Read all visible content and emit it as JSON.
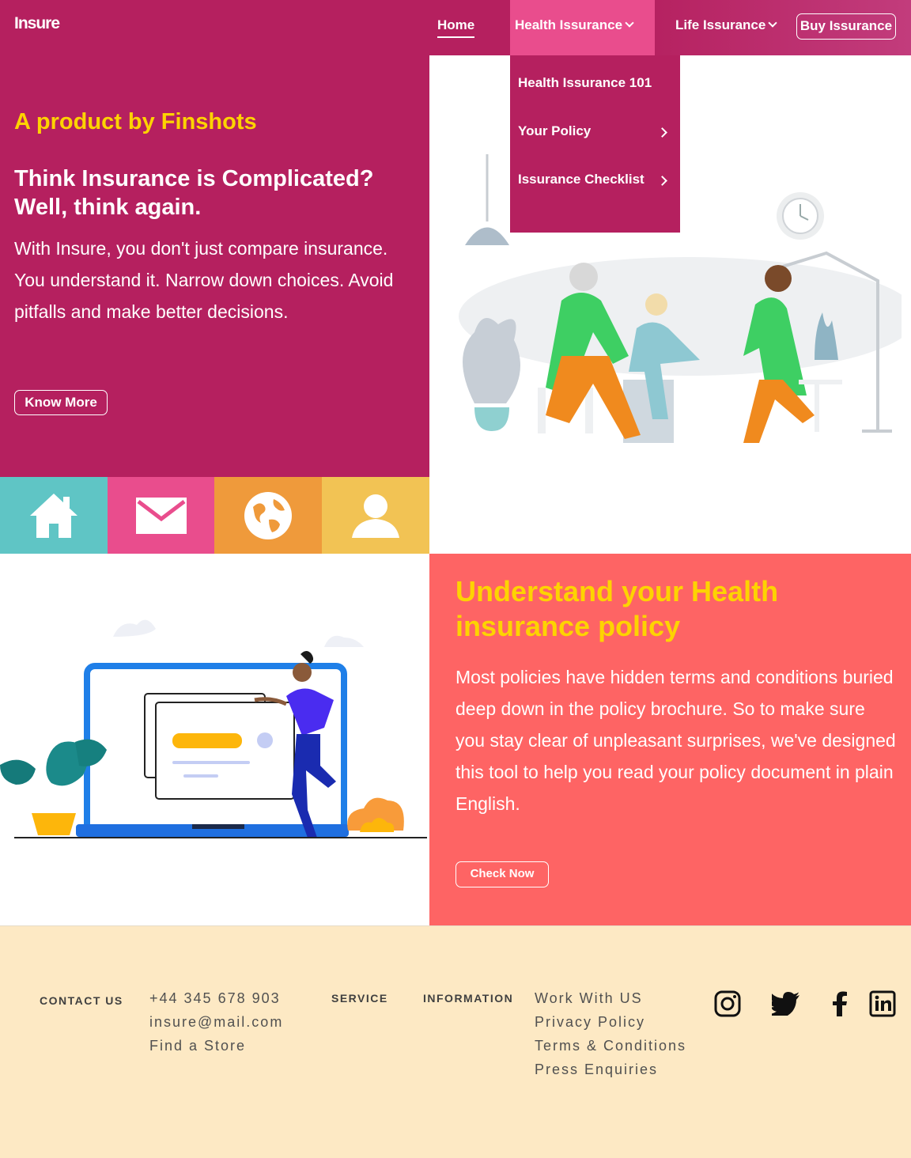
{
  "nav": {
    "logo": "Insure",
    "home": "Home",
    "health": "Health Issurance",
    "life": "Life Issurance",
    "buy": "Buy Issurance"
  },
  "dropdown": {
    "items": [
      "Health Issurance 101",
      "Your Policy",
      "Issurance Checklist"
    ]
  },
  "hero": {
    "tagline": "A product by Finshots",
    "title": "Think Insurance is Complicated? Well, think again.",
    "body": "With Insure, you don't just compare insurance. You understand it. Narrow down choices. Avoid pitfalls and make better decisions.",
    "button": "Know More"
  },
  "tiles": [
    "home-icon",
    "mail-icon",
    "globe-icon",
    "user-icon"
  ],
  "policy": {
    "title": "Understand your Health insurance policy",
    "body": "Most policies have hidden terms and conditions buried deep down in the policy brochure. So to make sure you stay clear of unpleasant surprises, we've designed this tool to help you read your policy document in plain English.",
    "button": "Check Now"
  },
  "footer": {
    "contact_heading": "CONTACT US",
    "contact": [
      "+44 345 678 903",
      "insure@mail.com",
      "Find a Store"
    ],
    "service_heading": "SERVICE",
    "information_heading": "INFORMATION",
    "information": [
      "Work With US",
      "Privacy Policy",
      "Terms & Conditions",
      "Press Enquiries"
    ],
    "social": [
      "instagram-icon",
      "twitter-icon",
      "facebook-icon",
      "linkedin-icon"
    ]
  },
  "colors": {
    "brand": "#b5205f",
    "accent_pink": "#e94d8d",
    "yellow": "#fdd301",
    "coral": "#fe6464",
    "footer_bg": "#fde9c4"
  }
}
